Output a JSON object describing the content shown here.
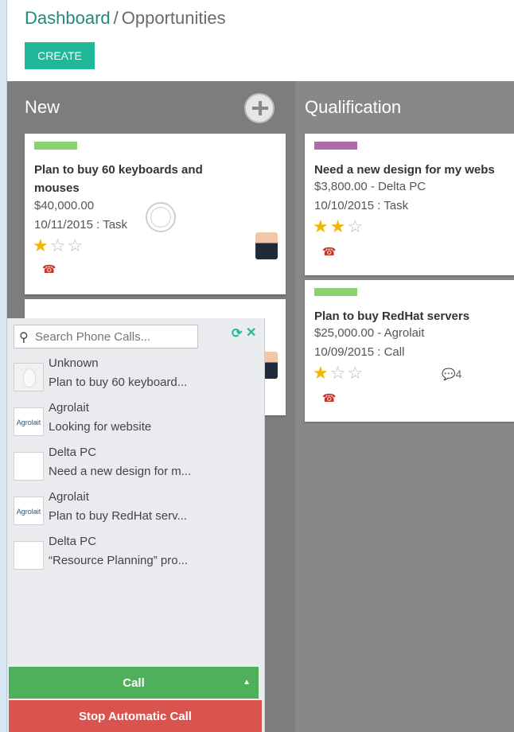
{
  "breadcrumb": {
    "parent": "Dashboard",
    "separator": "/",
    "current": "Opportunities"
  },
  "toolbar": {
    "create_label": "CREATE"
  },
  "columns": [
    {
      "title": "New"
    },
    {
      "title": "Qualification"
    }
  ],
  "cards": [
    {
      "title_line1": "Plan to buy 60 keyboards and",
      "title_line2": "mouses",
      "amount": "$40,000.00",
      "activity": "10/11/2015 : Task",
      "stars": 1,
      "tag_color": "#8ad46f"
    },
    {
      "title_line1": "Need a new design for my webs",
      "amount": "$3,800.00 - Delta PC",
      "activity": "10/10/2015 : Task",
      "stars": 2,
      "tag_color": "#b06aa8"
    },
    {
      "title_line1": "Plan to buy RedHat servers",
      "amount": "$25,000.00 - Agrolait",
      "activity": "10/09/2015 : Call",
      "stars": 1,
      "messages": "4",
      "tag_color": "#8ad46f"
    }
  ],
  "phone_panel": {
    "search_placeholder": "Search Phone Calls...",
    "calls": [
      {
        "name": "Unknown",
        "description": "Plan to buy 60 keyboard...",
        "logo": ""
      },
      {
        "name": "Agrolait",
        "description": "Looking for website",
        "logo": "Agrolait"
      },
      {
        "name": "Delta PC",
        "description": "Need a new design for m...",
        "logo": ""
      },
      {
        "name": "Agrolait",
        "description": "Plan to buy RedHat serv...",
        "logo": "Agrolait"
      },
      {
        "name": "Delta PC",
        "description": "“Resource Planning” pro...",
        "logo": ""
      }
    ],
    "call_label": "Call",
    "stop_label": "Stop Automatic Call"
  },
  "colors": {
    "accent": "#21b799",
    "call_green": "#4eb05a",
    "stop_red": "#d9534f"
  }
}
